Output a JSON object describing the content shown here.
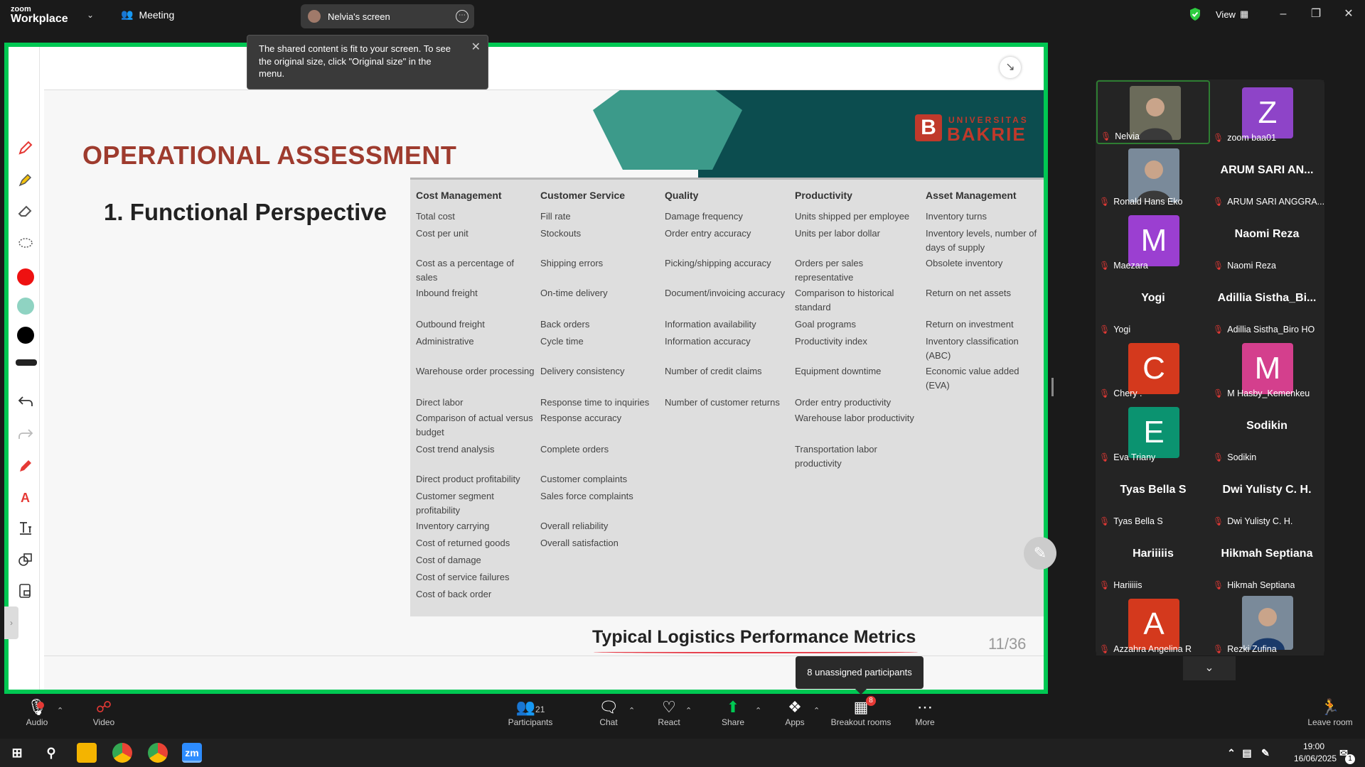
{
  "topbar": {
    "brand_line1": "zoom",
    "brand_line2": "Workplace",
    "meeting_label": "Meeting",
    "screen_tab_label": "Nelvia's screen",
    "view_label": "View"
  },
  "tooltip": {
    "text": "The shared content is fit to your screen. To see the original size, click \"Original size\" in the menu."
  },
  "slide": {
    "logo_small": "UNIVERSITAS",
    "logo_big": "BAKRIE",
    "logo_letter": "B",
    "title": "OPERATIONAL ASSESSMENT",
    "subtitle": "1. Functional Perspective",
    "footer_title": "Typical Logistics Performance Metrics",
    "page_number": "11/36",
    "columns": [
      "Cost Management",
      "Customer Service",
      "Quality",
      "Productivity",
      "Asset Management"
    ],
    "cost_management": [
      "Total cost",
      "Cost per unit",
      "Cost as a percentage of sales",
      "Inbound freight",
      "Outbound freight",
      "Administrative",
      "Warehouse order processing",
      "Direct labor",
      "Comparison of actual versus budget",
      "Cost trend analysis",
      "Direct product profitability",
      "Customer segment profitability",
      "Inventory carrying",
      "Cost of returned goods",
      "Cost of damage",
      "Cost of service failures",
      "Cost of back order"
    ],
    "customer_service": [
      "Fill rate",
      "Stockouts",
      "Shipping errors",
      "On-time delivery",
      "Back orders",
      "Cycle time",
      "Delivery consistency",
      "Response time to inquiries",
      "Response accuracy",
      "Complete orders",
      "Customer complaints",
      "Sales force complaints",
      "Overall reliability",
      "Overall satisfaction"
    ],
    "quality": [
      "Damage frequency",
      "Order entry accuracy",
      "Picking/shipping accuracy",
      "Document/invoicing accuracy",
      "Information availability",
      "Information accuracy",
      "Number of credit claims",
      "Number of customer returns"
    ],
    "productivity": [
      "Units shipped per employee",
      "Units per labor dollar",
      "Orders per sales representative",
      "Comparison to historical standard",
      "Goal programs",
      "Productivity index",
      "Equipment downtime",
      "Order entry productivity",
      "Warehouse labor productivity",
      "Transportation labor productivity"
    ],
    "asset_management": [
      "Inventory turns",
      "Inventory levels, number of days of supply",
      "Obsolete inventory",
      "Return on net assets",
      "Return on investment",
      "Inventory classification (ABC)",
      "Economic value added (EVA)"
    ]
  },
  "unassigned_tip": "8 unassigned participants",
  "gallery": [
    {
      "name": "Nelvia",
      "type": "photo"
    },
    {
      "name": "zoom baa01",
      "type": "avatar",
      "letter": "Z",
      "color": "#8e44c8"
    },
    {
      "name": "Ronald Hans Eko",
      "type": "photo"
    },
    {
      "name": "ARUM SARI ANGGRA...",
      "type": "text",
      "big": "ARUM SARI AN..."
    },
    {
      "name": "Maezara",
      "type": "avatar",
      "letter": "M",
      "color": "#9b3fd1"
    },
    {
      "name": "Naomi Reza",
      "type": "text",
      "big": "Naomi Reza"
    },
    {
      "name": "Yogi",
      "type": "text",
      "big": "Yogi"
    },
    {
      "name": "Adillia Sistha_Biro HO",
      "type": "text",
      "big": "Adillia  Sistha_Bi..."
    },
    {
      "name": "Chery .",
      "type": "avatar",
      "letter": "C",
      "color": "#d4391d"
    },
    {
      "name": "M Hasby_Kemenkeu",
      "type": "avatar",
      "letter": "M",
      "color": "#d43f8d"
    },
    {
      "name": "Eva Triany",
      "type": "avatar",
      "letter": "E",
      "color": "#0b9370"
    },
    {
      "name": "Sodikin",
      "type": "text",
      "big": "Sodikin"
    },
    {
      "name": "Tyas Bella S",
      "type": "text",
      "big": "Tyas Bella S"
    },
    {
      "name": "Dwi Yulisty C. H.",
      "type": "text",
      "big": "Dwi Yulisty C. H."
    },
    {
      "name": "Hariiiiis",
      "type": "text",
      "big": "Hariiiiis"
    },
    {
      "name": "Hikmah Septiana",
      "type": "text",
      "big": "Hikmah Septiana"
    },
    {
      "name": "Azzahra Angelina R",
      "type": "avatar",
      "letter": "A",
      "color": "#d4391d"
    },
    {
      "name": "Rezki Zufina",
      "type": "photo"
    }
  ],
  "toolbar": {
    "audio": "Audio",
    "video": "Video",
    "participants": "Participants",
    "participants_count": "21",
    "chat": "Chat",
    "react": "React",
    "share": "Share",
    "apps": "Apps",
    "breakout": "Breakout rooms",
    "breakout_badge": "8",
    "more": "More",
    "leave": "Leave room"
  },
  "taskbar": {
    "time": "19:00",
    "date": "16/06/2025",
    "zoom_label": "zm",
    "notif_count": "1"
  },
  "colors": {
    "share_border": "#00c853",
    "title_red": "#9e3b2e",
    "mute_red": "#e53935"
  }
}
